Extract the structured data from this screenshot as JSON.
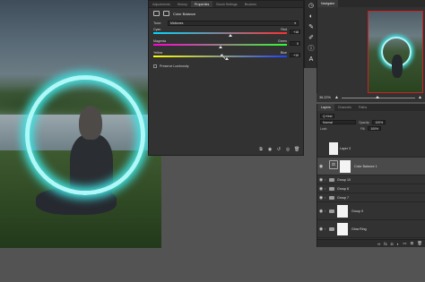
{
  "properties": {
    "tabs": [
      "Adjustments",
      "History",
      "Properties",
      "Brush Settings",
      "Brushes"
    ],
    "active_tab": 2,
    "title": "Color Balance",
    "tone_label": "Tone:",
    "tone_value": "Midtones",
    "sliders": [
      {
        "left": "Cyan",
        "right": "Red",
        "value_text": "+16",
        "value": 16,
        "gradient": [
          "#00d8ff",
          "#ff3030"
        ]
      },
      {
        "left": "Magenta",
        "right": "Green",
        "value_text": "0",
        "value": 0,
        "gradient": [
          "#ff00d8",
          "#30ff30"
        ]
      },
      {
        "left": "Yellow",
        "right": "Blue",
        "value_text": "+10",
        "value": 10,
        "gradient": [
          "#ffff00",
          "#2040ff"
        ]
      }
    ],
    "slider_range": [
      -100,
      100
    ],
    "preserve_label": "Preserve Luminosity",
    "preserve_checked": false
  },
  "navigator": {
    "tab": "Navigator",
    "zoom": "36.22%",
    "zoom_level": 0.46
  },
  "layers_panel": {
    "tabs": [
      "Layers",
      "Channels",
      "Paths"
    ],
    "kind_label": "Q Kind",
    "blend_mode": "Normal",
    "opacity_label": "Opacity:",
    "opacity_value": "100%",
    "lock_label": "Lock:",
    "fill_label": "Fill:",
    "fill_value": "100%",
    "layers": [
      {
        "name": "Layer 3",
        "type": "pixel"
      },
      {
        "name": "Color Balance 1",
        "type": "adjustment",
        "selected": true
      },
      {
        "name": "Group 10",
        "type": "group"
      },
      {
        "name": "Group 8",
        "type": "group"
      },
      {
        "name": "Group 7",
        "type": "group"
      },
      {
        "name": "Group 9",
        "type": "group-mask"
      },
      {
        "name": "Glow Ring",
        "type": "group-mask"
      }
    ]
  },
  "colors": {
    "panel_bg": "#323232",
    "ring_glow": "#3fe6e6",
    "navigator_frame": "#cc2222"
  }
}
